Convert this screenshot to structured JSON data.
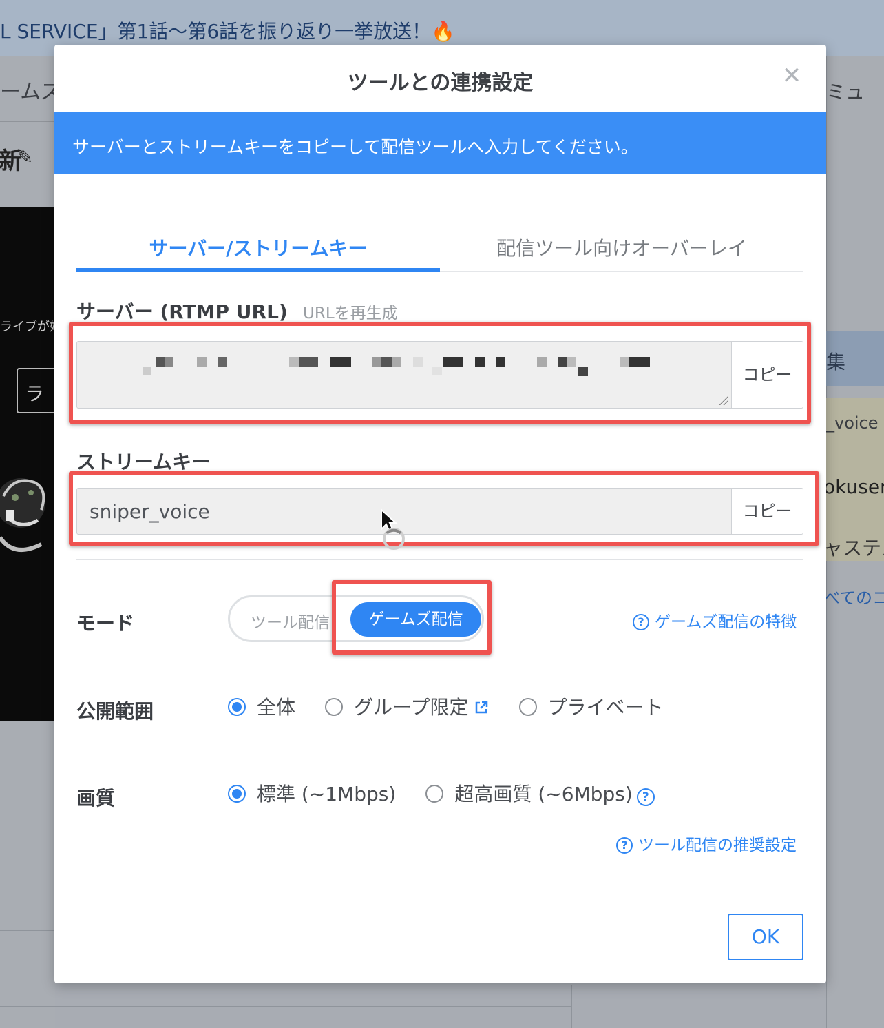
{
  "background": {
    "top_banner": "L SERVICE」第1話〜第6話を振り返り一挙放送！🔥",
    "left_nav_fragment": "ームズ配",
    "left_heading_fragment": "新",
    "video_text_fragment": "ライブが始",
    "video_button_fragment": "ラ",
    "right_nav_fragment": "ミュ",
    "right_edit_fragment": "集",
    "right_user_fragment": "_voice",
    "right_user2_fragment": "okusen",
    "right_text_fragment": "ャステス",
    "right_link_fragment": "べてのコ"
  },
  "modal": {
    "title": "ツールとの連携設定",
    "close_icon": "close-icon",
    "banner": "サーバーとストリームキーをコピーして配信ツールへ入力してください。",
    "tabs": [
      {
        "label": "サーバー/ストリームキー",
        "active": true
      },
      {
        "label": "配信ツール向けオーバーレイ",
        "active": false
      }
    ],
    "server": {
      "label": "サーバー (RTMP URL)",
      "regen_link": "URLを再生成",
      "value": "",
      "copy_label": "コピー"
    },
    "stream_key": {
      "label": "ストリームキー",
      "value": "sniper_voice",
      "copy_label": "コピー"
    },
    "mode": {
      "label": "モード",
      "options": [
        "ツール配信",
        "ゲームズ配信"
      ],
      "selected": "ゲームズ配信",
      "help_link": "ゲームズ配信の特徴"
    },
    "visibility": {
      "label": "公開範囲",
      "options": [
        "全体",
        "グループ限定",
        "プライベート"
      ],
      "selected": "全体"
    },
    "quality": {
      "label": "画質",
      "options": [
        "標準 (~1Mbps)",
        "超高画質 (~6Mbps)"
      ],
      "selected": "標準 (~1Mbps)",
      "help_link": "ツール配信の推奨設定"
    },
    "ok_label": "OK"
  },
  "colors": {
    "accent": "#2f86f3",
    "banner": "#3a8ef6",
    "highlight": "#ef5350"
  }
}
